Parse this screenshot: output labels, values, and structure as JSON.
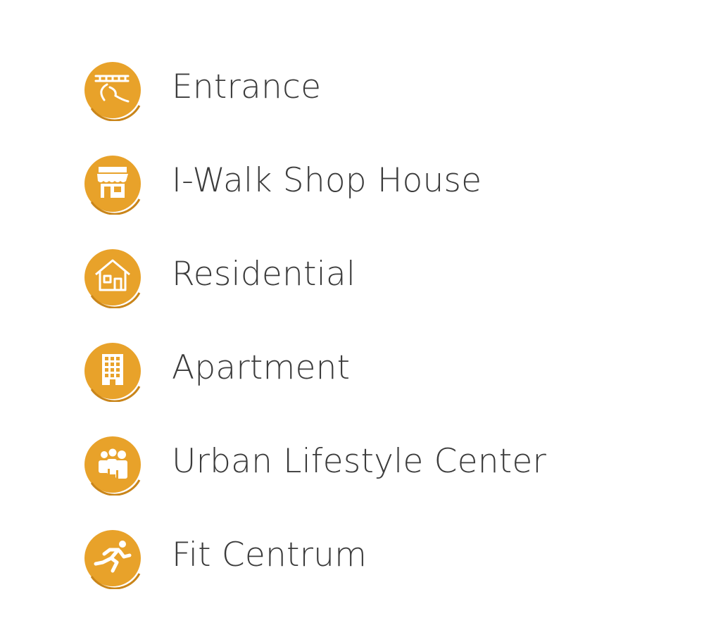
{
  "colors": {
    "accent": "#E8A22A",
    "accent_dark": "#C9851A",
    "icon_white": "#FFFFFF",
    "label_text": "#3B3B3B"
  },
  "legend": {
    "items": [
      {
        "label": "Entrance",
        "icon": "gate-icon"
      },
      {
        "label": "I-Walk Shop House",
        "icon": "shop-icon"
      },
      {
        "label": "Residential",
        "icon": "house-icon"
      },
      {
        "label": "Apartment",
        "icon": "apartment-building-icon"
      },
      {
        "label": "Urban Lifestyle Center",
        "icon": "people-group-icon"
      },
      {
        "label": "Fit Centrum",
        "icon": "runner-icon"
      }
    ]
  }
}
